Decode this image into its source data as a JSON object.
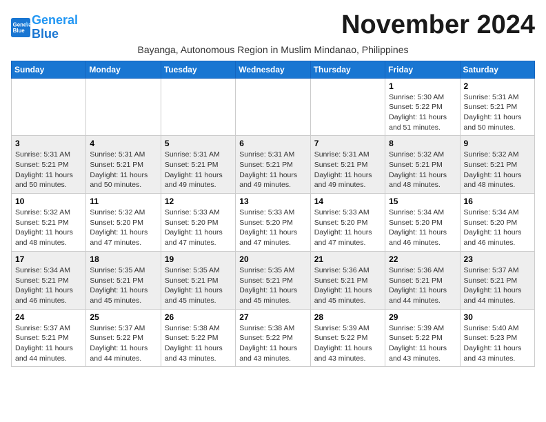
{
  "header": {
    "logo_line1": "General",
    "logo_line2": "Blue",
    "month_title": "November 2024",
    "subtitle": "Bayanga, Autonomous Region in Muslim Mindanao, Philippines"
  },
  "calendar": {
    "days_of_week": [
      "Sunday",
      "Monday",
      "Tuesday",
      "Wednesday",
      "Thursday",
      "Friday",
      "Saturday"
    ],
    "weeks": [
      [
        {
          "day": "",
          "info": ""
        },
        {
          "day": "",
          "info": ""
        },
        {
          "day": "",
          "info": ""
        },
        {
          "day": "",
          "info": ""
        },
        {
          "day": "",
          "info": ""
        },
        {
          "day": "1",
          "info": "Sunrise: 5:30 AM\nSunset: 5:22 PM\nDaylight: 11 hours and 51 minutes."
        },
        {
          "day": "2",
          "info": "Sunrise: 5:31 AM\nSunset: 5:21 PM\nDaylight: 11 hours and 50 minutes."
        }
      ],
      [
        {
          "day": "3",
          "info": "Sunrise: 5:31 AM\nSunset: 5:21 PM\nDaylight: 11 hours and 50 minutes."
        },
        {
          "day": "4",
          "info": "Sunrise: 5:31 AM\nSunset: 5:21 PM\nDaylight: 11 hours and 50 minutes."
        },
        {
          "day": "5",
          "info": "Sunrise: 5:31 AM\nSunset: 5:21 PM\nDaylight: 11 hours and 49 minutes."
        },
        {
          "day": "6",
          "info": "Sunrise: 5:31 AM\nSunset: 5:21 PM\nDaylight: 11 hours and 49 minutes."
        },
        {
          "day": "7",
          "info": "Sunrise: 5:31 AM\nSunset: 5:21 PM\nDaylight: 11 hours and 49 minutes."
        },
        {
          "day": "8",
          "info": "Sunrise: 5:32 AM\nSunset: 5:21 PM\nDaylight: 11 hours and 48 minutes."
        },
        {
          "day": "9",
          "info": "Sunrise: 5:32 AM\nSunset: 5:21 PM\nDaylight: 11 hours and 48 minutes."
        }
      ],
      [
        {
          "day": "10",
          "info": "Sunrise: 5:32 AM\nSunset: 5:21 PM\nDaylight: 11 hours and 48 minutes."
        },
        {
          "day": "11",
          "info": "Sunrise: 5:32 AM\nSunset: 5:20 PM\nDaylight: 11 hours and 47 minutes."
        },
        {
          "day": "12",
          "info": "Sunrise: 5:33 AM\nSunset: 5:20 PM\nDaylight: 11 hours and 47 minutes."
        },
        {
          "day": "13",
          "info": "Sunrise: 5:33 AM\nSunset: 5:20 PM\nDaylight: 11 hours and 47 minutes."
        },
        {
          "day": "14",
          "info": "Sunrise: 5:33 AM\nSunset: 5:20 PM\nDaylight: 11 hours and 47 minutes."
        },
        {
          "day": "15",
          "info": "Sunrise: 5:34 AM\nSunset: 5:20 PM\nDaylight: 11 hours and 46 minutes."
        },
        {
          "day": "16",
          "info": "Sunrise: 5:34 AM\nSunset: 5:20 PM\nDaylight: 11 hours and 46 minutes."
        }
      ],
      [
        {
          "day": "17",
          "info": "Sunrise: 5:34 AM\nSunset: 5:21 PM\nDaylight: 11 hours and 46 minutes."
        },
        {
          "day": "18",
          "info": "Sunrise: 5:35 AM\nSunset: 5:21 PM\nDaylight: 11 hours and 45 minutes."
        },
        {
          "day": "19",
          "info": "Sunrise: 5:35 AM\nSunset: 5:21 PM\nDaylight: 11 hours and 45 minutes."
        },
        {
          "day": "20",
          "info": "Sunrise: 5:35 AM\nSunset: 5:21 PM\nDaylight: 11 hours and 45 minutes."
        },
        {
          "day": "21",
          "info": "Sunrise: 5:36 AM\nSunset: 5:21 PM\nDaylight: 11 hours and 45 minutes."
        },
        {
          "day": "22",
          "info": "Sunrise: 5:36 AM\nSunset: 5:21 PM\nDaylight: 11 hours and 44 minutes."
        },
        {
          "day": "23",
          "info": "Sunrise: 5:37 AM\nSunset: 5:21 PM\nDaylight: 11 hours and 44 minutes."
        }
      ],
      [
        {
          "day": "24",
          "info": "Sunrise: 5:37 AM\nSunset: 5:21 PM\nDaylight: 11 hours and 44 minutes."
        },
        {
          "day": "25",
          "info": "Sunrise: 5:37 AM\nSunset: 5:22 PM\nDaylight: 11 hours and 44 minutes."
        },
        {
          "day": "26",
          "info": "Sunrise: 5:38 AM\nSunset: 5:22 PM\nDaylight: 11 hours and 43 minutes."
        },
        {
          "day": "27",
          "info": "Sunrise: 5:38 AM\nSunset: 5:22 PM\nDaylight: 11 hours and 43 minutes."
        },
        {
          "day": "28",
          "info": "Sunrise: 5:39 AM\nSunset: 5:22 PM\nDaylight: 11 hours and 43 minutes."
        },
        {
          "day": "29",
          "info": "Sunrise: 5:39 AM\nSunset: 5:22 PM\nDaylight: 11 hours and 43 minutes."
        },
        {
          "day": "30",
          "info": "Sunrise: 5:40 AM\nSunset: 5:23 PM\nDaylight: 11 hours and 43 minutes."
        }
      ]
    ]
  }
}
